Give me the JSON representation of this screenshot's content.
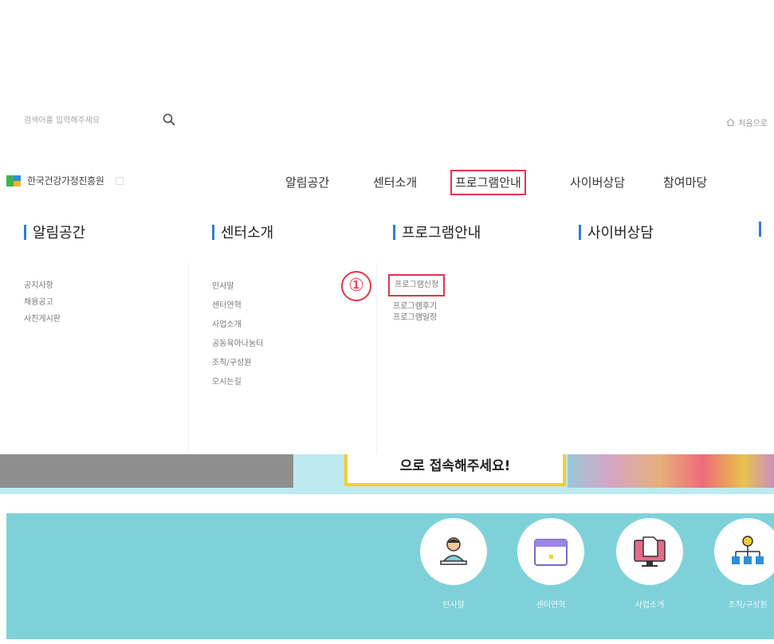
{
  "search": {
    "placeholder": "검색어를 입력해주세요"
  },
  "utility": {
    "home_label": "처음으로"
  },
  "logo": {
    "text": "한국건강가정진흥원"
  },
  "gnb": [
    {
      "label": "알림공간"
    },
    {
      "label": "센터소개"
    },
    {
      "label": "프로그램안내"
    },
    {
      "label": "사이버상담"
    },
    {
      "label": "참여마당"
    }
  ],
  "megamenu": {
    "columns": [
      {
        "title": "알림공간",
        "items": [
          "공지사항",
          "채용공고",
          "사진게시판"
        ]
      },
      {
        "title": "센터소개",
        "items": [
          "인사말",
          "센터연혁",
          "사업소개",
          "공동육아나눔터",
          "조직/구성원",
          "오시는길"
        ]
      },
      {
        "title": "프로그램안내",
        "items": [
          "프로그램신청",
          "프로그램후기",
          "프로그램일정"
        ]
      },
      {
        "title": "사이버상담",
        "items": []
      },
      {
        "title": "",
        "items": []
      }
    ],
    "step_marker": "①"
  },
  "banner": {
    "text": "으로 접속해주세요!"
  },
  "quick_menu": [
    {
      "label": "인사말",
      "icon": "person-laptop-icon"
    },
    {
      "label": "센터연혁",
      "icon": "calendar-icon"
    },
    {
      "label": "사업소개",
      "icon": "monitor-document-icon"
    },
    {
      "label": "조직/구성원",
      "icon": "org-chart-icon"
    }
  ],
  "colors": {
    "highlight": "#e2344c",
    "title_bar": "#2d7fd6",
    "quick_band": "#7fd1d9",
    "banner_bg": "#bfe9f0",
    "banner_border": "#f1cf33"
  }
}
